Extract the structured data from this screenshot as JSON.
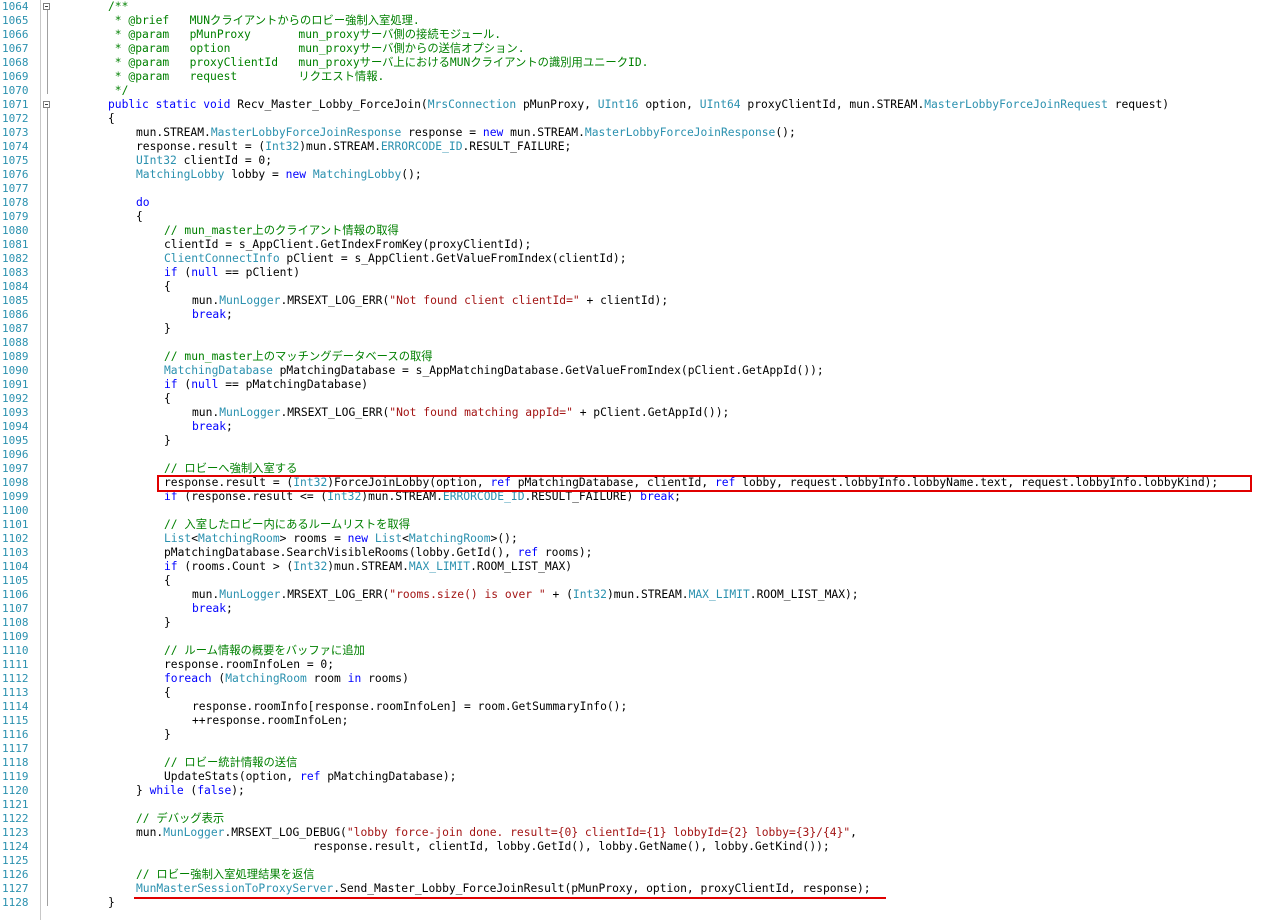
{
  "colors": {
    "comment": "#008000",
    "keyword": "#0000ff",
    "type": "#2b91af",
    "string": "#a31515",
    "plain": "#000000",
    "line_number": "#2b91af",
    "highlight": "#e00000"
  },
  "code_lines": [
    {
      "n": "1064",
      "indent": 2,
      "t": [
        [
          "c",
          "/**"
        ]
      ]
    },
    {
      "n": "1065",
      "indent": 2,
      "t": [
        [
          "c",
          " * @brief   MUNクライアントからのロビー強制入室処理."
        ]
      ]
    },
    {
      "n": "1066",
      "indent": 2,
      "t": [
        [
          "c",
          " * @param   pMunProxy       mun_proxyサーバ側の接続モジュール."
        ]
      ]
    },
    {
      "n": "1067",
      "indent": 2,
      "t": [
        [
          "c",
          " * @param   option          mun_proxyサーバ側からの送信オプション."
        ]
      ]
    },
    {
      "n": "1068",
      "indent": 2,
      "t": [
        [
          "c",
          " * @param   proxyClientId   mun_proxyサーバ上におけるMUNクライアントの識別用ユニークID."
        ]
      ]
    },
    {
      "n": "1069",
      "indent": 2,
      "t": [
        [
          "c",
          " * @param   request         リクエスト情報."
        ]
      ]
    },
    {
      "n": "1070",
      "indent": 2,
      "t": [
        [
          "c",
          " */"
        ]
      ]
    },
    {
      "n": "1071",
      "indent": 2,
      "t": [
        [
          "k",
          "public"
        ],
        [
          "p",
          " "
        ],
        [
          "k",
          "static"
        ],
        [
          "p",
          " "
        ],
        [
          "k",
          "void"
        ],
        [
          "p",
          " Recv_Master_Lobby_ForceJoin("
        ],
        [
          "t",
          "MrsConnection"
        ],
        [
          "p",
          " pMunProxy, "
        ],
        [
          "t",
          "UInt16"
        ],
        [
          "p",
          " option, "
        ],
        [
          "t",
          "UInt64"
        ],
        [
          "p",
          " proxyClientId, mun.STREAM."
        ],
        [
          "t",
          "MasterLobbyForceJoinRequest"
        ],
        [
          "p",
          " request)"
        ]
      ]
    },
    {
      "n": "1072",
      "indent": 2,
      "t": [
        [
          "p",
          "{"
        ]
      ]
    },
    {
      "n": "1073",
      "indent": 3,
      "t": [
        [
          "p",
          "mun.STREAM."
        ],
        [
          "t",
          "MasterLobbyForceJoinResponse"
        ],
        [
          "p",
          " response = "
        ],
        [
          "k",
          "new"
        ],
        [
          "p",
          " mun.STREAM."
        ],
        [
          "t",
          "MasterLobbyForceJoinResponse"
        ],
        [
          "p",
          "();"
        ]
      ]
    },
    {
      "n": "1074",
      "indent": 3,
      "t": [
        [
          "p",
          "response.result = ("
        ],
        [
          "t",
          "Int32"
        ],
        [
          "p",
          ")mun.STREAM."
        ],
        [
          "t",
          "ERRORCODE_ID"
        ],
        [
          "p",
          ".RESULT_FAILURE;"
        ]
      ]
    },
    {
      "n": "1075",
      "indent": 3,
      "t": [
        [
          "t",
          "UInt32"
        ],
        [
          "p",
          " clientId = 0;"
        ]
      ]
    },
    {
      "n": "1076",
      "indent": 3,
      "t": [
        [
          "t",
          "MatchingLobby"
        ],
        [
          "p",
          " lobby = "
        ],
        [
          "k",
          "new"
        ],
        [
          "p",
          " "
        ],
        [
          "t",
          "MatchingLobby"
        ],
        [
          "p",
          "();"
        ]
      ]
    },
    {
      "n": "1077",
      "indent": 3,
      "t": []
    },
    {
      "n": "1078",
      "indent": 3,
      "t": [
        [
          "k",
          "do"
        ]
      ]
    },
    {
      "n": "1079",
      "indent": 3,
      "t": [
        [
          "p",
          "{"
        ]
      ]
    },
    {
      "n": "1080",
      "indent": 4,
      "t": [
        [
          "c",
          "// mun_master上のクライアント情報の取得"
        ]
      ]
    },
    {
      "n": "1081",
      "indent": 4,
      "t": [
        [
          "p",
          "clientId = s_AppClient.GetIndexFromKey(proxyClientId);"
        ]
      ]
    },
    {
      "n": "1082",
      "indent": 4,
      "t": [
        [
          "t",
          "ClientConnectInfo"
        ],
        [
          "p",
          " pClient = s_AppClient.GetValueFromIndex(clientId);"
        ]
      ]
    },
    {
      "n": "1083",
      "indent": 4,
      "t": [
        [
          "k",
          "if"
        ],
        [
          "p",
          " ("
        ],
        [
          "k",
          "null"
        ],
        [
          "p",
          " == pClient)"
        ]
      ]
    },
    {
      "n": "1084",
      "indent": 4,
      "t": [
        [
          "p",
          "{"
        ]
      ]
    },
    {
      "n": "1085",
      "indent": 5,
      "t": [
        [
          "p",
          "mun."
        ],
        [
          "t",
          "MunLogger"
        ],
        [
          "p",
          ".MRSEXT_LOG_ERR("
        ],
        [
          "s",
          "\"Not found client clientId=\""
        ],
        [
          "p",
          " + clientId);"
        ]
      ]
    },
    {
      "n": "1086",
      "indent": 5,
      "t": [
        [
          "k",
          "break"
        ],
        [
          "p",
          ";"
        ]
      ]
    },
    {
      "n": "1087",
      "indent": 4,
      "t": [
        [
          "p",
          "}"
        ]
      ]
    },
    {
      "n": "1088",
      "indent": 4,
      "t": []
    },
    {
      "n": "1089",
      "indent": 4,
      "t": [
        [
          "c",
          "// mun_master上のマッチングデータベースの取得"
        ]
      ]
    },
    {
      "n": "1090",
      "indent": 4,
      "t": [
        [
          "t",
          "MatchingDatabase"
        ],
        [
          "p",
          " pMatchingDatabase = s_AppMatchingDatabase.GetValueFromIndex(pClient.GetAppId());"
        ]
      ]
    },
    {
      "n": "1091",
      "indent": 4,
      "t": [
        [
          "k",
          "if"
        ],
        [
          "p",
          " ("
        ],
        [
          "k",
          "null"
        ],
        [
          "p",
          " == pMatchingDatabase)"
        ]
      ]
    },
    {
      "n": "1092",
      "indent": 4,
      "t": [
        [
          "p",
          "{"
        ]
      ]
    },
    {
      "n": "1093",
      "indent": 5,
      "t": [
        [
          "p",
          "mun."
        ],
        [
          "t",
          "MunLogger"
        ],
        [
          "p",
          ".MRSEXT_LOG_ERR("
        ],
        [
          "s",
          "\"Not found matching appId=\""
        ],
        [
          "p",
          " + pClient.GetAppId());"
        ]
      ]
    },
    {
      "n": "1094",
      "indent": 5,
      "t": [
        [
          "k",
          "break"
        ],
        [
          "p",
          ";"
        ]
      ]
    },
    {
      "n": "1095",
      "indent": 4,
      "t": [
        [
          "p",
          "}"
        ]
      ]
    },
    {
      "n": "1096",
      "indent": 4,
      "t": []
    },
    {
      "n": "1097",
      "indent": 4,
      "t": [
        [
          "c",
          "// ロビーへ強制入室する"
        ]
      ]
    },
    {
      "n": "1098",
      "indent": 4,
      "t": [
        [
          "p",
          "response.result = ("
        ],
        [
          "t",
          "Int32"
        ],
        [
          "p",
          ")ForceJoinLobby(option, "
        ],
        [
          "k",
          "ref"
        ],
        [
          "p",
          " pMatchingDatabase, clientId, "
        ],
        [
          "k",
          "ref"
        ],
        [
          "p",
          " lobby, request.lobbyInfo.lobbyName.text, request.lobbyInfo.lobbyKind);"
        ]
      ]
    },
    {
      "n": "1099",
      "indent": 4,
      "t": [
        [
          "k",
          "if"
        ],
        [
          "p",
          " (response.result <= ("
        ],
        [
          "t",
          "Int32"
        ],
        [
          "p",
          ")mun.STREAM."
        ],
        [
          "t",
          "ERRORCODE_ID"
        ],
        [
          "p",
          ".RESULT_FAILURE) "
        ],
        [
          "k",
          "break"
        ],
        [
          "p",
          ";"
        ]
      ]
    },
    {
      "n": "1100",
      "indent": 4,
      "t": []
    },
    {
      "n": "1101",
      "indent": 4,
      "t": [
        [
          "c",
          "// 入室したロビー内にあるルームリストを取得"
        ]
      ]
    },
    {
      "n": "1102",
      "indent": 4,
      "t": [
        [
          "t",
          "List"
        ],
        [
          "p",
          "<"
        ],
        [
          "t",
          "MatchingRoom"
        ],
        [
          "p",
          "> rooms = "
        ],
        [
          "k",
          "new"
        ],
        [
          "p",
          " "
        ],
        [
          "t",
          "List"
        ],
        [
          "p",
          "<"
        ],
        [
          "t",
          "MatchingRoom"
        ],
        [
          "p",
          ">();"
        ]
      ]
    },
    {
      "n": "1103",
      "indent": 4,
      "t": [
        [
          "p",
          "pMatchingDatabase.SearchVisibleRooms(lobby.GetId(), "
        ],
        [
          "k",
          "ref"
        ],
        [
          "p",
          " rooms);"
        ]
      ]
    },
    {
      "n": "1104",
      "indent": 4,
      "t": [
        [
          "k",
          "if"
        ],
        [
          "p",
          " (rooms.Count > ("
        ],
        [
          "t",
          "Int32"
        ],
        [
          "p",
          ")mun.STREAM."
        ],
        [
          "t",
          "MAX_LIMIT"
        ],
        [
          "p",
          ".ROOM_LIST_MAX)"
        ]
      ]
    },
    {
      "n": "1105",
      "indent": 4,
      "t": [
        [
          "p",
          "{"
        ]
      ]
    },
    {
      "n": "1106",
      "indent": 5,
      "t": [
        [
          "p",
          "mun."
        ],
        [
          "t",
          "MunLogger"
        ],
        [
          "p",
          ".MRSEXT_LOG_ERR("
        ],
        [
          "s",
          "\"rooms.size() is over \""
        ],
        [
          "p",
          " + ("
        ],
        [
          "t",
          "Int32"
        ],
        [
          "p",
          ")mun.STREAM."
        ],
        [
          "t",
          "MAX_LIMIT"
        ],
        [
          "p",
          ".ROOM_LIST_MAX);"
        ]
      ]
    },
    {
      "n": "1107",
      "indent": 5,
      "t": [
        [
          "k",
          "break"
        ],
        [
          "p",
          ";"
        ]
      ]
    },
    {
      "n": "1108",
      "indent": 4,
      "t": [
        [
          "p",
          "}"
        ]
      ]
    },
    {
      "n": "1109",
      "indent": 4,
      "t": []
    },
    {
      "n": "1110",
      "indent": 4,
      "t": [
        [
          "c",
          "// ルーム情報の概要をバッファに追加"
        ]
      ]
    },
    {
      "n": "1111",
      "indent": 4,
      "t": [
        [
          "p",
          "response.roomInfoLen = 0;"
        ]
      ]
    },
    {
      "n": "1112",
      "indent": 4,
      "t": [
        [
          "k",
          "foreach"
        ],
        [
          "p",
          " ("
        ],
        [
          "t",
          "MatchingRoom"
        ],
        [
          "p",
          " room "
        ],
        [
          "k",
          "in"
        ],
        [
          "p",
          " rooms)"
        ]
      ]
    },
    {
      "n": "1113",
      "indent": 4,
      "t": [
        [
          "p",
          "{"
        ]
      ]
    },
    {
      "n": "1114",
      "indent": 5,
      "t": [
        [
          "p",
          "response.roomInfo[response.roomInfoLen] = room.GetSummaryInfo();"
        ]
      ]
    },
    {
      "n": "1115",
      "indent": 5,
      "t": [
        [
          "p",
          "++response.roomInfoLen;"
        ]
      ]
    },
    {
      "n": "1116",
      "indent": 4,
      "t": [
        [
          "p",
          "}"
        ]
      ]
    },
    {
      "n": "1117",
      "indent": 4,
      "t": []
    },
    {
      "n": "1118",
      "indent": 4,
      "t": [
        [
          "c",
          "// ロビー統計情報の送信"
        ]
      ]
    },
    {
      "n": "1119",
      "indent": 4,
      "t": [
        [
          "p",
          "UpdateStats(option, "
        ],
        [
          "k",
          "ref"
        ],
        [
          "p",
          " pMatchingDatabase);"
        ]
      ]
    },
    {
      "n": "1120",
      "indent": 3,
      "t": [
        [
          "p",
          "} "
        ],
        [
          "k",
          "while"
        ],
        [
          "p",
          " ("
        ],
        [
          "k",
          "false"
        ],
        [
          "p",
          ");"
        ]
      ]
    },
    {
      "n": "1121",
      "indent": 3,
      "t": []
    },
    {
      "n": "1122",
      "indent": 3,
      "t": [
        [
          "c",
          "// デバッグ表示"
        ]
      ]
    },
    {
      "n": "1123",
      "indent": 3,
      "t": [
        [
          "p",
          "mun."
        ],
        [
          "t",
          "MunLogger"
        ],
        [
          "p",
          ".MRSEXT_LOG_DEBUG("
        ],
        [
          "s",
          "\"lobby force-join done. result={0} clientId={1} lobbyId={2} lobby={3}/{4}\""
        ],
        [
          "p",
          ","
        ]
      ]
    },
    {
      "n": "1124",
      "indent": 3,
      "t": [
        [
          "p",
          "                          response.result, clientId, lobby.GetId(), lobby.GetName(), lobby.GetKind());"
        ]
      ]
    },
    {
      "n": "1125",
      "indent": 3,
      "t": []
    },
    {
      "n": "1126",
      "indent": 3,
      "t": [
        [
          "c",
          "// ロビー強制入室処理結果を返信"
        ]
      ]
    },
    {
      "n": "1127",
      "indent": 3,
      "t": [
        [
          "t",
          "MunMasterSessionToProxyServer"
        ],
        [
          "p",
          ".Send_Master_Lobby_ForceJoinResult(pMunProxy, option, proxyClientId, response);"
        ]
      ]
    },
    {
      "n": "1128",
      "indent": 2,
      "t": [
        [
          "p",
          "}"
        ]
      ]
    }
  ]
}
